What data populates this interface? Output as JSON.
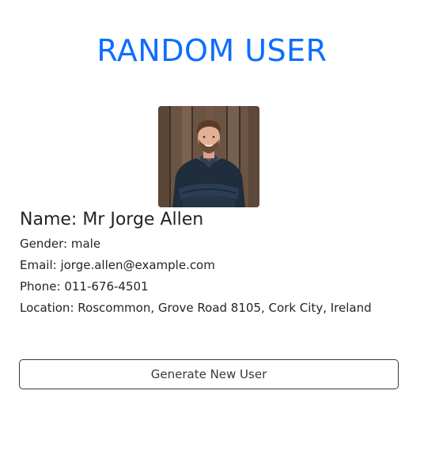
{
  "header": {
    "title": "RANDOM USER"
  },
  "user": {
    "avatar_icon": "user-portrait",
    "name_label": "Name:",
    "name": "Mr Jorge Allen",
    "gender_label": "Gender:",
    "gender": "male",
    "email_label": "Email:",
    "email": "jorge.allen@example.com",
    "phone_label": "Phone:",
    "phone": "011-676-4501",
    "location_label": "Location:",
    "location": "Roscommon, Grove Road 8105, Cork City, Ireland"
  },
  "actions": {
    "generate_label": "Generate New User"
  },
  "colors": {
    "title": "#0d6efd",
    "text": "#212529",
    "button_border": "#343a40"
  }
}
